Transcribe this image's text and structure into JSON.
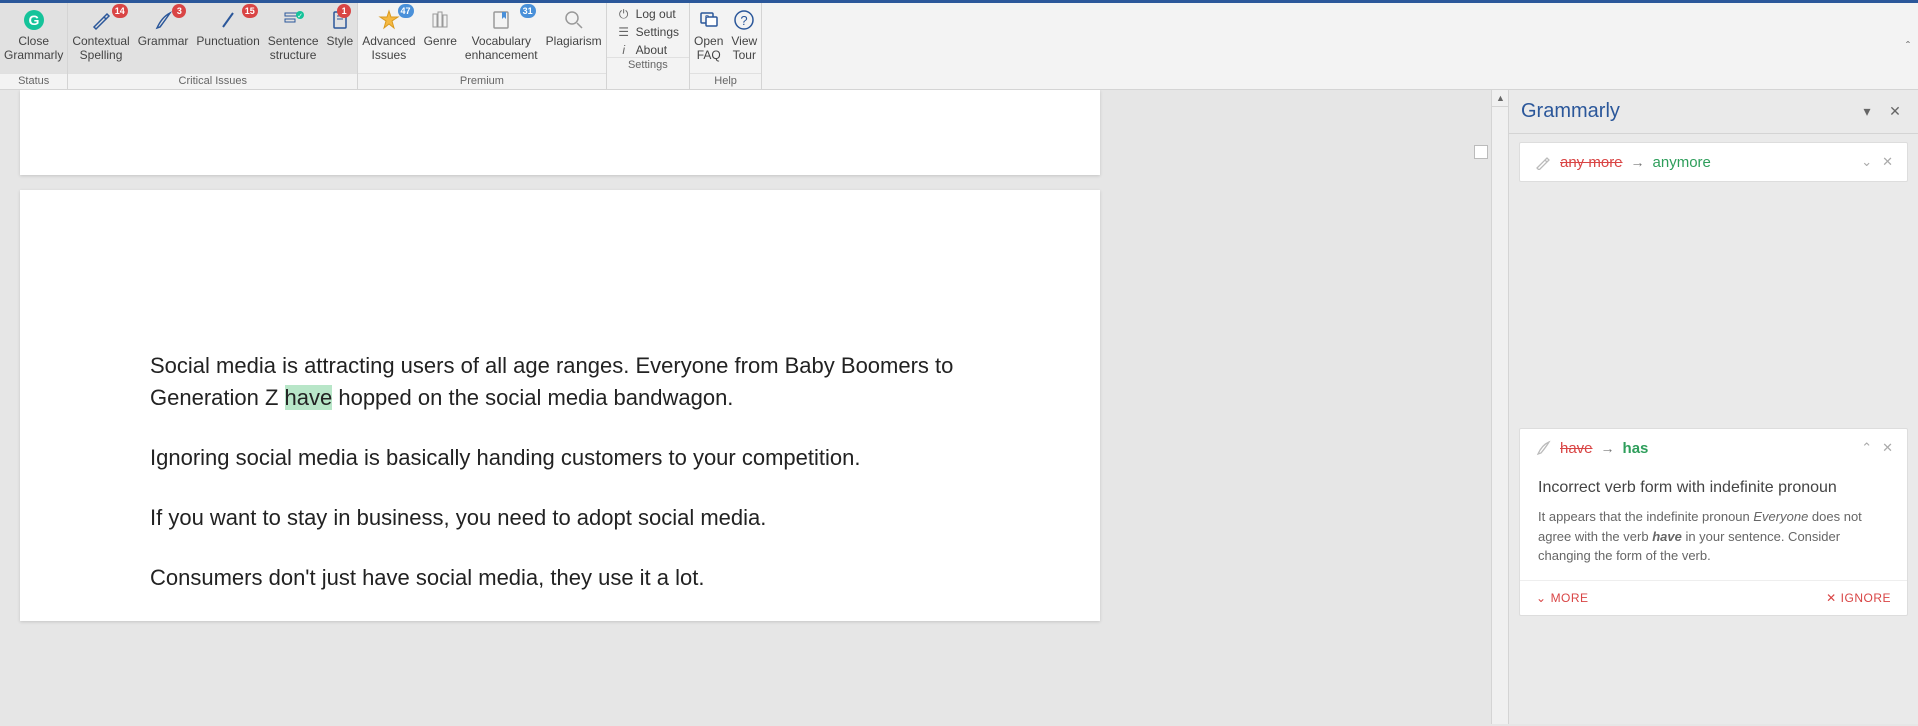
{
  "ribbon": {
    "close": {
      "line1": "Close",
      "line2": "Grammarly"
    },
    "contextual": {
      "line1": "Contextual",
      "line2": "Spelling",
      "badge": "14"
    },
    "grammar": {
      "label": "Grammar",
      "badge": "3"
    },
    "punctuation": {
      "label": "Punctuation",
      "badge": "15"
    },
    "sentence": {
      "line1": "Sentence",
      "line2": "structure"
    },
    "style": {
      "label": "Style",
      "badge": "1"
    },
    "advanced": {
      "line1": "Advanced",
      "line2": "Issues",
      "badge": "47"
    },
    "genre": {
      "label": "Genre"
    },
    "vocab": {
      "line1": "Vocabulary",
      "line2": "enhancement",
      "badge": "31"
    },
    "plag": {
      "label": "Plagiarism"
    },
    "logout": "Log out",
    "settings": "Settings",
    "about": "About",
    "openfaq": {
      "line1": "Open",
      "line2": "FAQ"
    },
    "viewtour": {
      "line1": "View",
      "line2": "Tour"
    },
    "groups": {
      "status": "Status",
      "critical": "Critical Issues",
      "premium": "Premium",
      "settings": "Settings",
      "help": "Help"
    }
  },
  "document": {
    "p1a": "Social media is attracting users of all age ranges. Everyone from Baby Boomers to Generation Z ",
    "p1hl": "have",
    "p1b": " hopped on the social media bandwagon.",
    "p2": "Ignoring social media is basically handing customers to your competition.",
    "p3": "If you want to stay in business,  you need to adopt social media.",
    "p4": "Consumers don't just have social media, they use it a lot."
  },
  "panel": {
    "title": "Grammarly",
    "card1": {
      "from": "any more",
      "to": "anymore"
    },
    "card2": {
      "from": "have",
      "to": "has",
      "title": "Incorrect verb form with indefinite pronoun",
      "d1": "It appears that the indefinite pronoun ",
      "d2": "Everyone",
      "d3": " does not agree with the verb ",
      "d4": "have",
      "d5": " in your sentence. Consider changing the form of the verb.",
      "more": "MORE",
      "ignore": "IGNORE"
    }
  }
}
